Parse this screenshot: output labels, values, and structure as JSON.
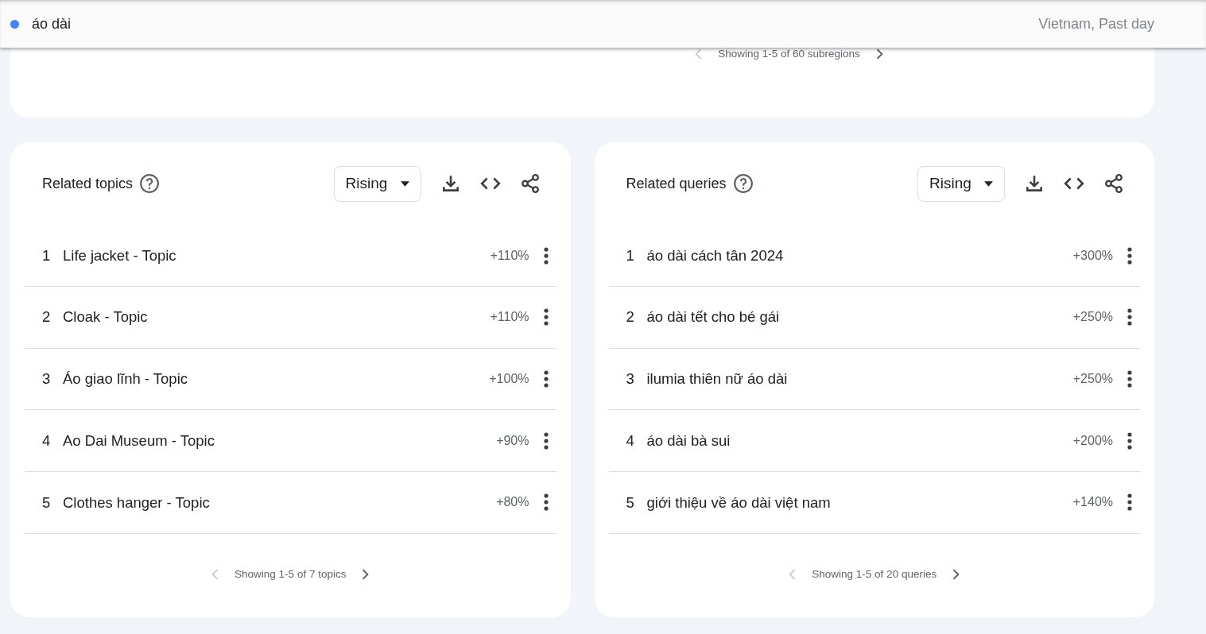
{
  "header": {
    "term": "áo dài",
    "color": "#4285f4",
    "scope": "Vietnam, Past day"
  },
  "top_card": {
    "pager": {
      "text": "Showing 1-5 of 60 subregions",
      "prev_enabled": false,
      "next_enabled": true
    }
  },
  "panels": [
    {
      "title": "Related topics",
      "dropdown": "Rising",
      "rows": [
        {
          "rank": "1",
          "label": "Life jacket - Topic",
          "value": "+110%"
        },
        {
          "rank": "2",
          "label": "Cloak - Topic",
          "value": "+110%"
        },
        {
          "rank": "3",
          "label": "Áo giao lĩnh - Topic",
          "value": "+100%"
        },
        {
          "rank": "4",
          "label": "Ao Dai Museum - Topic",
          "value": "+90%"
        },
        {
          "rank": "5",
          "label": "Clothes hanger - Topic",
          "value": "+80%"
        }
      ],
      "pager": {
        "text": "Showing 1-5 of 7 topics",
        "prev_enabled": false,
        "next_enabled": true
      }
    },
    {
      "title": "Related queries",
      "dropdown": "Rising",
      "rows": [
        {
          "rank": "1",
          "label": "áo dài cách tân 2024",
          "value": "+300%"
        },
        {
          "rank": "2",
          "label": "áo dài tết cho bé gái",
          "value": "+250%"
        },
        {
          "rank": "3",
          "label": "ilumia thiên nữ áo dài",
          "value": "+250%"
        },
        {
          "rank": "4",
          "label": "áo dài bà sui",
          "value": "+200%"
        },
        {
          "rank": "5",
          "label": "giới thiệu về áo dài việt nam",
          "value": "+140%"
        }
      ],
      "pager": {
        "text": "Showing 1-5 of 20 queries",
        "prev_enabled": false,
        "next_enabled": true
      }
    }
  ]
}
